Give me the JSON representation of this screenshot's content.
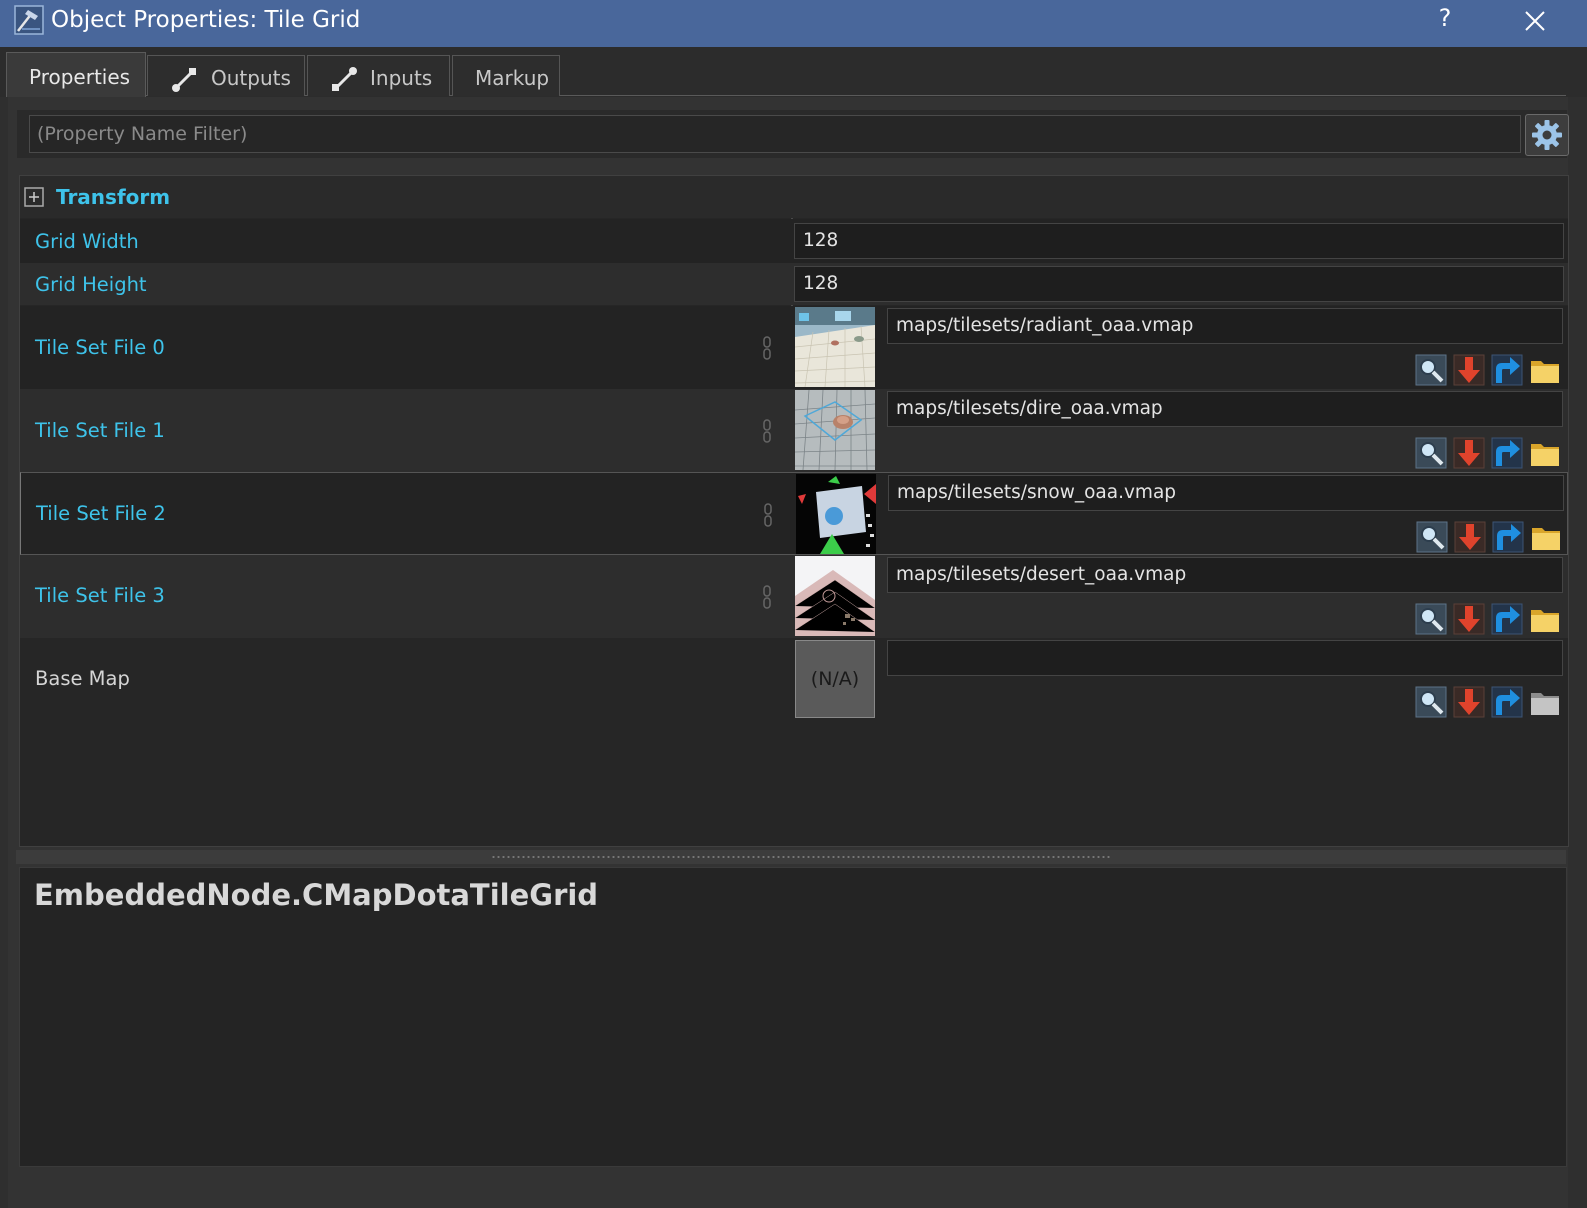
{
  "window": {
    "title": "Object Properties: Tile Grid",
    "help_label": "?",
    "titlebar_color": "#49679b"
  },
  "tabs": [
    {
      "label": "Properties",
      "icon": "none",
      "active": true
    },
    {
      "label": "Outputs",
      "icon": "output-connector-icon",
      "active": false
    },
    {
      "label": "Inputs",
      "icon": "input-connector-icon",
      "active": false
    },
    {
      "label": "Markup",
      "icon": "none",
      "active": false
    }
  ],
  "filter": {
    "placeholder": "(Property Name Filter)",
    "value": ""
  },
  "group": {
    "name": "Transform",
    "expander": "plus-icon"
  },
  "properties": {
    "grid_width": {
      "label": "Grid Width",
      "value": "128"
    },
    "grid_height": {
      "label": "Grid Height",
      "value": "128"
    },
    "tile_sets": [
      {
        "label": "Tile Set File 0",
        "path": "maps/tilesets/radiant_oaa.vmap"
      },
      {
        "label": "Tile Set File 1",
        "path": "maps/tilesets/dire_oaa.vmap"
      },
      {
        "label": "Tile Set File 2",
        "path": "maps/tilesets/snow_oaa.vmap"
      },
      {
        "label": "Tile Set File 3",
        "path": "maps/tilesets/desert_oaa.vmap"
      }
    ],
    "base_map": {
      "label": "Base Map",
      "path": "",
      "thumb_text": "(N/A)"
    }
  },
  "file_tools": [
    "magnifier-icon",
    "pick-arrow-down-icon",
    "goto-arrow-icon",
    "folder-icon"
  ],
  "description": {
    "text": "EmbeddedNode.CMapDotaTileGrid"
  },
  "colors": {
    "property_label": "#3ec3ea",
    "accent": "#2a9ad8"
  }
}
